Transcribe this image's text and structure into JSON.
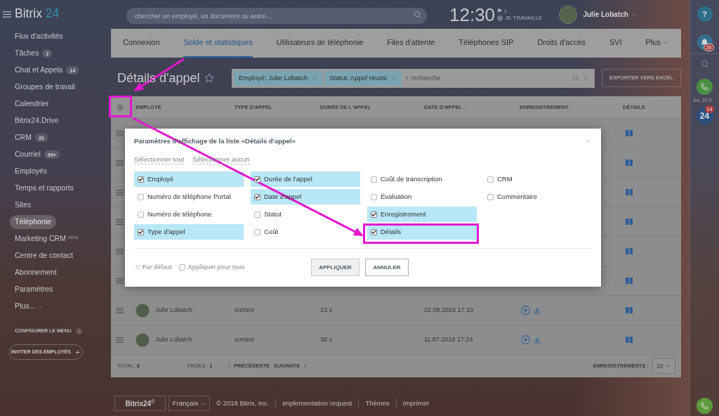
{
  "sidebar": {
    "logo": {
      "name": "Bitrix",
      "suffix": "24"
    },
    "items": [
      {
        "label": "Flux d'activités",
        "kind": "link",
        "selected": false
      },
      {
        "label": "Tâches",
        "badge": "2",
        "kind": "link",
        "selected": false
      },
      {
        "label": "Chat et Appels",
        "badge": "14",
        "kind": "link",
        "selected": false
      },
      {
        "label": "Groupes de travail",
        "kind": "link",
        "selected": false
      },
      {
        "label": "Calendrier",
        "kind": "link",
        "selected": false
      },
      {
        "label": "Bitrix24.Drive",
        "kind": "link",
        "selected": false
      },
      {
        "label": "CRM",
        "badge": "20",
        "kind": "link",
        "selected": false
      },
      {
        "label": "Courriel",
        "badge": "99+",
        "kind": "link",
        "selected": false
      },
      {
        "label": "Employés",
        "kind": "link",
        "selected": false
      },
      {
        "label": "Temps et rapports",
        "kind": "link",
        "selected": false
      },
      {
        "label": "Sites",
        "kind": "link",
        "selected": false
      },
      {
        "label": "Téléphonie",
        "kind": "link",
        "selected": true
      },
      {
        "label": "Marketing CRM",
        "tag": "beta",
        "kind": "link",
        "selected": false
      },
      {
        "label": "Centre de contact",
        "kind": "link",
        "selected": false
      },
      {
        "label": "Abonnement",
        "kind": "link",
        "selected": false
      },
      {
        "label": "Paramètres",
        "kind": "link",
        "selected": false
      },
      {
        "label": "Plus...",
        "kind": "more",
        "selected": false
      }
    ],
    "configure_menu": "CONFIGURER LE MENU",
    "invite_button": "INVITER DES EMPLOYÉS"
  },
  "top_bar": {
    "search": {
      "placeholder": "chercher un employé, un document ou autre..."
    },
    "clock": "12:30",
    "flag_count": "1",
    "work_status": "JE TRAVAILLE",
    "user": {
      "name": "Julie Lobatch"
    }
  },
  "right_panel": {
    "help": "?",
    "notifications_badge": "26",
    "date": "Jeu. 20 D",
    "chat_label": "24",
    "chat_badge": "14"
  },
  "tabs": [
    {
      "label": "Connexion",
      "kind": "tab",
      "selected": false
    },
    {
      "label": "Solde et statistiques",
      "kind": "tab",
      "selected": true
    },
    {
      "label": "Utilisateurs de téléphonie",
      "kind": "tab",
      "selected": false
    },
    {
      "label": "Files d'attente",
      "kind": "tab",
      "selected": false
    },
    {
      "label": "Téléphones SIP",
      "kind": "tab",
      "selected": false
    },
    {
      "label": "Droits d'accès",
      "kind": "tab",
      "selected": false
    },
    {
      "label": "SVI",
      "kind": "tab",
      "selected": false
    },
    {
      "label": "Plus",
      "kind": "menu",
      "selected": false
    }
  ],
  "page": {
    "title": "Détails d'appel",
    "filter": {
      "chips": [
        "Employé: Julie Lobatch",
        "Statut: Appel réussi"
      ],
      "placeholder": "+ recherche"
    },
    "export_button": "EXPORTER VERS EXCEL"
  },
  "table": {
    "columns": [
      {
        "label": "EMPLOYÉ",
        "sorted": false
      },
      {
        "label": "TYPE D'APPEL",
        "sorted": false
      },
      {
        "label": "DURÉE DE L'APPEL",
        "sorted": false
      },
      {
        "label": "DATE D'APPEL",
        "sorted": true
      },
      {
        "label": "ENREGISTREMENT",
        "sorted": false
      },
      {
        "label": "DÉTAILS",
        "sorted": false
      }
    ],
    "rows": [
      {
        "kind": "covered"
      },
      {
        "kind": "covered"
      },
      {
        "kind": "covered"
      },
      {
        "kind": "covered"
      },
      {
        "kind": "covered"
      },
      {
        "kind": "covered"
      },
      {
        "kind": "full",
        "employee": "Julie Lobatch",
        "type": "sortant",
        "duration": "23 s",
        "date": "02.08.2018 17:10"
      },
      {
        "kind": "full",
        "employee": "Julie Lobatch",
        "type": "sortant",
        "duration": "38 s",
        "date": "11.07.2018 17:24"
      }
    ],
    "footer": {
      "total": "TOTAL: **8**",
      "pages": "PAGES : **1**",
      "previous": "PRÉCÉDENTE",
      "next": "SUIVANTE",
      "page_size_label": "ENREGISTREMENTS :",
      "page_size": "20"
    }
  },
  "dialog": {
    "title": "Paramètres d'affichage de la liste «Détails d'appel»",
    "select_all": "Sélectionner tout",
    "select_none": "Sélectionner aucun",
    "fields": [
      {
        "label": "Employé",
        "checked": true
      },
      {
        "label": "Numéro de téléphone Portal",
        "checked": false
      },
      {
        "label": "Numéro de téléphone",
        "checked": false
      },
      {
        "label": "Type d'appel",
        "checked": true
      },
      {
        "label": "Durée de l'appel",
        "checked": true
      },
      {
        "label": "Date d'appel",
        "checked": true
      },
      {
        "label": "Statut",
        "checked": false
      },
      {
        "label": "Coût",
        "checked": false
      },
      {
        "label": "Coût de transcription",
        "checked": false
      },
      {
        "label": "Évaluation",
        "checked": false
      },
      {
        "label": "Enregistrement",
        "checked": true
      },
      {
        "label": "Détails",
        "checked": true
      },
      {
        "label": "CRM",
        "checked": false
      },
      {
        "label": "Commentaire",
        "checked": false
      }
    ],
    "reset": "Par défaut",
    "apply_all": {
      "label": "Appliquer pour tous",
      "checked": false
    },
    "buttons": [
      {
        "label": "APPLIQUER",
        "kind": "primary"
      },
      {
        "label": "ANNULER",
        "kind": "secondary"
      }
    ]
  },
  "footer": {
    "logo": "Bitrix24$^{©}$",
    "language": "Français",
    "copyright": "© 2018 Bitrix, Inc.",
    "links": [
      "Implementation request",
      "Thèmes",
      "Imprimer"
    ]
  }
}
